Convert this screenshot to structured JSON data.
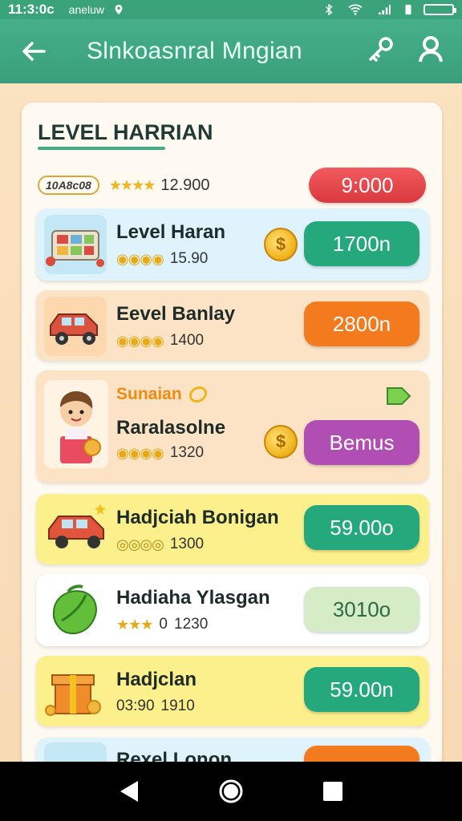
{
  "status_bar": {
    "time": "11:3:0c",
    "location": "aneluw"
  },
  "app_bar": {
    "title": "Slnkoasnral Mngian"
  },
  "header": {
    "title": "LEVEL HARRIAN",
    "badge": "10A8c08",
    "stars": "★★★★",
    "score": "12.900",
    "button": "9:000"
  },
  "rows": [
    {
      "title": "Level Haran",
      "coins": "◉◉◉◉",
      "value": "15.90",
      "button": "1700n",
      "btn_color": "#25a97c",
      "bg": "#def3fb"
    },
    {
      "title": "Eevel Banlay",
      "coins": "◉◉◉◉",
      "value": "1400",
      "button": "2800n",
      "btn_color": "#f47a1e",
      "bg": "#fde3c6"
    },
    {
      "tag": "Sunaian",
      "title": "Raralasolne",
      "coins": "◉◉◉◉",
      "value": "1320",
      "button": "Bemus",
      "btn_color": "#b04eb4",
      "bg": "#fde3c6"
    },
    {
      "title": "Hadjciah Bonigan",
      "coins": "◎◎◎◎",
      "value": "1300",
      "button": "59.00o",
      "btn_color": "#25a97c",
      "bg": "#fbf08b"
    },
    {
      "title": "Hadiaha Ylasgan",
      "coins": "★★★",
      "value": "1230",
      "prefix": "0",
      "button": "3010o",
      "btn_color": "#d5ecc7",
      "btn_text_color": "#2d6b45",
      "bg": "#ffffff"
    },
    {
      "title": "Hadjclan",
      "coins": "",
      "value": "1910",
      "prefix": "03:90",
      "button": "59.00n",
      "btn_color": "#25a97c",
      "bg": "#fbf08b"
    },
    {
      "title": "Rexel Lonon",
      "coins": "",
      "value": "",
      "button": "",
      "btn_color": "#f47a1e",
      "bg": "#def3fb"
    }
  ],
  "colors": {
    "accent": "#3fae86",
    "header_button": "#e04448"
  }
}
